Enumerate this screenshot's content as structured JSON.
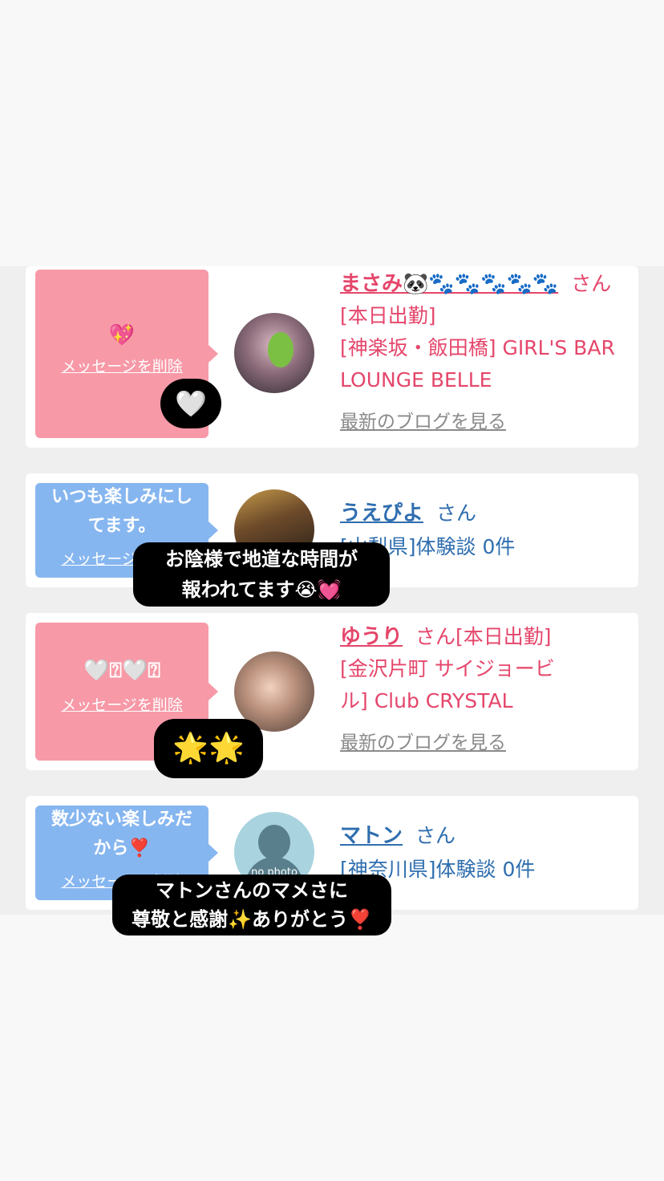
{
  "cards": [
    {
      "bubble_text": "💖",
      "delete_label": "メッセージを削除",
      "name": "まさみ🐼🐾🐾🐾🐾🐾",
      "san": "さん",
      "line1": "[本日出勤]",
      "line2": "[神楽坂・飯田橋] GIRL'S BAR",
      "line3": "LOUNGE BELLE",
      "blog_link": "最新のブログを見る"
    },
    {
      "bubble_text": "いつも楽しみにしてます。",
      "delete_label": "メッセージを削除",
      "name": "うえぴよ",
      "san": "さん",
      "line1": "[山梨県]体験談 0件"
    },
    {
      "bubble_text": "🤍⍰🤍⍰",
      "delete_label": "メッセージを削除",
      "name": "ゆうり",
      "san": "さん",
      "line1_inline": "[本日出勤]",
      "line2": "[金沢片町 サイジョービ",
      "line3": "ル] Club CRYSTAL",
      "blog_link": "最新のブログを見る"
    },
    {
      "bubble_text": "数少ない楽しみだから❣️",
      "delete_label": "メッセージを削除",
      "name": "マトン",
      "san": "さん",
      "line1": "[神奈川県]体験談 0件",
      "no_photo": "no photo"
    }
  ],
  "stickers": [
    {
      "lines": [
        "🤍"
      ]
    },
    {
      "lines": [
        "お陰様で地道な時間が",
        "報われてます😭💓"
      ]
    },
    {
      "lines": [
        "🌟🌟"
      ]
    },
    {
      "lines": [
        "マトンさんのマメさに",
        "尊敬と感謝✨ありがとう❣️"
      ]
    }
  ]
}
